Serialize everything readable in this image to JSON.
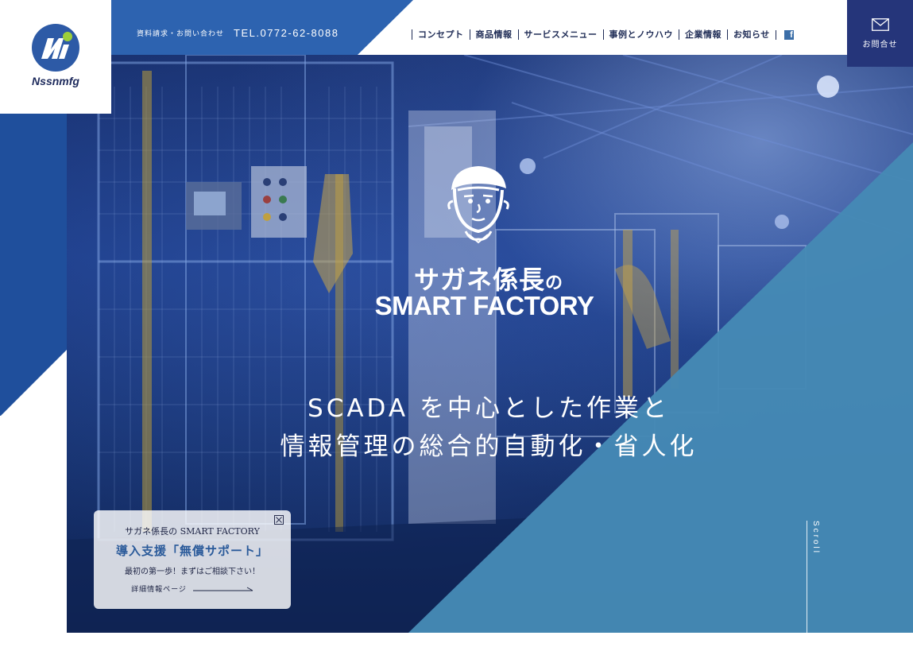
{
  "brand": {
    "name": "Nssnmfg"
  },
  "header": {
    "contact_label": "資料請求・お問い合わせ",
    "tel": "TEL.0772-62-8088",
    "nav": [
      "コンセプト",
      "商品情報",
      "サービスメニュー",
      "事例とノウハウ",
      "企業情報",
      "お知らせ"
    ],
    "facebook_icon": "facebook-icon",
    "contact_button": {
      "label": "お問合せ",
      "icon": "mail-icon"
    }
  },
  "hero": {
    "logo_jp": "サガネ係長",
    "logo_jp_particle": "の",
    "logo_en": "SMART FACTORY",
    "tagline_line1": "SCADA を中心とした作業と",
    "tagline_line2": "情報管理の総合的自動化・省人化",
    "scroll_label": "Scroll"
  },
  "support_card": {
    "subtitle": "サガネ係長の SMART FACTORY",
    "title": "導入支援「無償サポート」",
    "note": "最初の第一歩！まずはご相談下さい！",
    "link_label": "詳細情報ページ"
  },
  "colors": {
    "header_blue": "#2d63b0",
    "contact_navy": "#25357a",
    "diagonal_blue": "#4589b5",
    "nav_text": "#1e2b55"
  }
}
